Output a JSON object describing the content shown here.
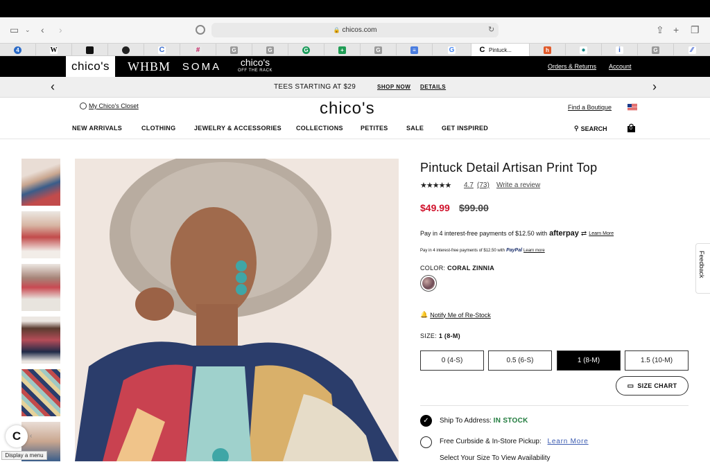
{
  "browser": {
    "url": "chicos.com",
    "active_tab_title": "Pintuck..."
  },
  "brands": {
    "chicos": "chico's",
    "whbm": "WHBM",
    "soma": "SOMA",
    "rack_top": "chico's",
    "rack_bottom": "OFF THE RACK"
  },
  "top_links": {
    "orders": "Orders & Returns",
    "account": "Account"
  },
  "promo": {
    "text": "TEES STARTING AT $29",
    "shop_now": "SHOP NOW",
    "details": "DETAILS"
  },
  "header": {
    "closet": "My Chico's Closet",
    "logo": "chico's",
    "find_boutique": "Find a Boutique",
    "search": "SEARCH",
    "cart_count": "0"
  },
  "nav": {
    "items": [
      "NEW ARRIVALS",
      "CLOTHING",
      "JEWELRY & ACCESSORIES",
      "COLLECTIONS",
      "PETITES",
      "SALE",
      "GET INSPIRED"
    ]
  },
  "product": {
    "title": "Pintuck Detail Artisan Print Top",
    "stars": "★★★★★",
    "rating": "4.7",
    "review_count": "(73)",
    "write_review": "Write a review",
    "sale_price": "$49.99",
    "original_price": "$99.00",
    "afterpay_text": "Pay in 4 interest-free payments of $12.50 with",
    "afterpay_brand": "afterpay",
    "afterpay_learn": "Learn More",
    "paypal_text": "Pay in 4 interest-free payments of $12.50 with",
    "paypal_brand": "PayPal",
    "paypal_learn": "Learn more",
    "color_label": "COLOR:",
    "color_value": "CORAL ZINNIA",
    "notify": "Notify Me of Re-Stock",
    "size_label": "SIZE:",
    "size_value": "1 (8-M)",
    "sizes": [
      "0 (4-S)",
      "0.5 (6-S)",
      "1 (8-M)",
      "1.5 (10-M)"
    ],
    "selected_size_index": 2,
    "size_chart": "SIZE CHART"
  },
  "shipping": {
    "ship_label": "Ship To Address:",
    "ship_status": "IN STOCK",
    "pickup_label": "Free Curbside & In-Store Pickup:",
    "pickup_link": "Learn More",
    "availability": "Select Your Size To View Availability"
  },
  "widgets": {
    "feedback": "Feedback",
    "display_menu": "Display a menu",
    "badge": "C"
  },
  "colors": {
    "sale": "#d0112b",
    "in_stock": "#1f7a3c",
    "link_blue": "#3a5ab0"
  }
}
